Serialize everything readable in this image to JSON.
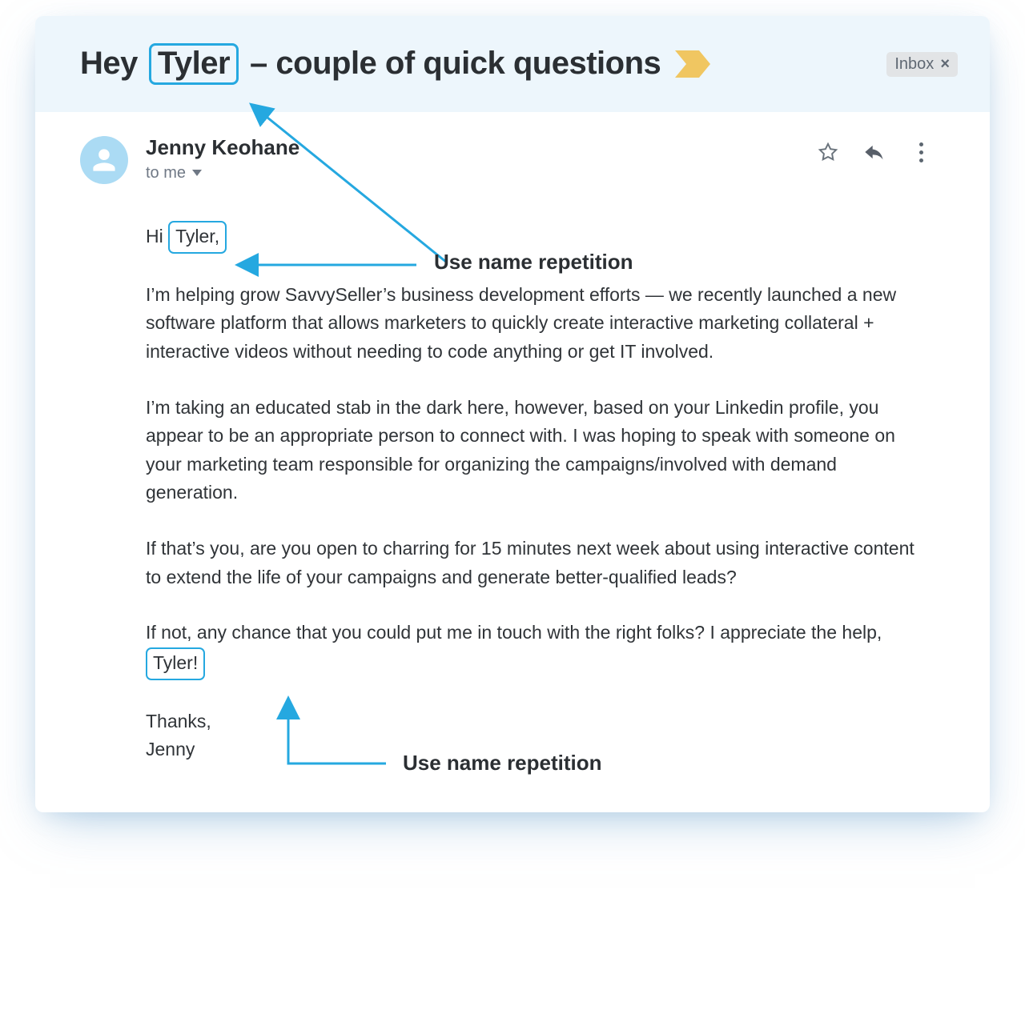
{
  "subject": {
    "pre": "Hey",
    "highlighted_name": "Tyler",
    "post": "– couple of quick questions"
  },
  "inbox_badge": {
    "label": "Inbox",
    "close": "×"
  },
  "sender": {
    "name": "Jenny Keohane"
  },
  "recipient_line": "to me",
  "actions": {
    "star_icon": "star-icon",
    "reply_icon": "reply-icon",
    "more_icon": "more-icon"
  },
  "greeting": {
    "pre": "Hi",
    "highlighted": "Tyler,"
  },
  "paragraphs": [
    "I’m helping grow SavvySeller’s business development efforts — we recently launched a new software platform that allows marketers to quickly create interactive marketing collateral + interactive videos without needing to code anything or get IT involved.",
    "I’m taking an educated stab in the dark here, however, based on your Linkedin profile, you appear to be an appropriate person to connect with. I was hoping to speak with someone on your marketing team responsible for organizing the campaigns/involved with demand generation.",
    "If that’s you, are you open to charring for 15 minutes next week about using interactive content to extend the life of your campaigns and generate better-qualified leads?"
  ],
  "closing_paragraph": {
    "pre": "If not, any chance that you could put me in touch with the right folks? I appreciate the help,",
    "highlighted": "Tyler!"
  },
  "signoff": {
    "thanks": "Thanks,",
    "name": "Jenny"
  },
  "annotations": {
    "top": "Use name repetition",
    "bottom": "Use name repetition"
  },
  "colors": {
    "highlight": "#25a8e0",
    "accent_chevron": "#f0c661"
  }
}
